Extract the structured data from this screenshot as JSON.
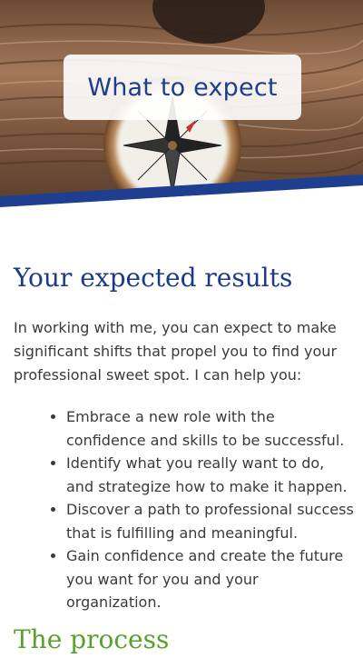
{
  "hero": {
    "title": "What to expect"
  },
  "results": {
    "heading": "Your expected results",
    "intro": "In working with me, you can expect to make significant shifts that propel you to find your professional sweet spot. I can help you:",
    "items": [
      "Embrace a new role with the confidence and skills to be successful.",
      "Identify what you really want to do, and strategize how to make it happen.",
      "Discover a path to professional success that is fulfilling and meaningful.",
      "Gain confidence and create the future you want for you and your organization."
    ]
  },
  "process": {
    "heading": "The process"
  },
  "colors": {
    "heading_blue": "#1c3a8a",
    "heading_green": "#5aa02c",
    "band_blue": "#1e3f8f"
  }
}
